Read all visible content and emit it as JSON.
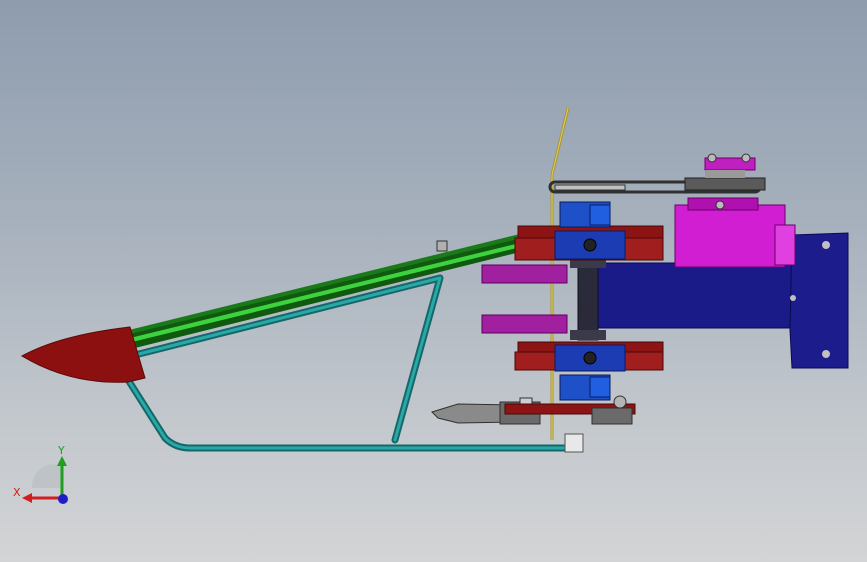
{
  "viewport": {
    "background_top": "#8e9cae",
    "background_bottom": "#d3d4d6"
  },
  "triad": {
    "x_label": "X",
    "y_label": "Y",
    "x_color": "#d21e1e",
    "y_color": "#1ea01e",
    "z_color": "#1e1ec8"
  },
  "colors": {
    "frame": "#1f8c8c",
    "tube": "#2faf2f",
    "handle_tip": "#a01818",
    "gearbox": "#d21ed2",
    "mount": "#1e1e96",
    "clamp": "#1e3cb4",
    "bracket": "#a01e1e",
    "belt": "#404040"
  }
}
